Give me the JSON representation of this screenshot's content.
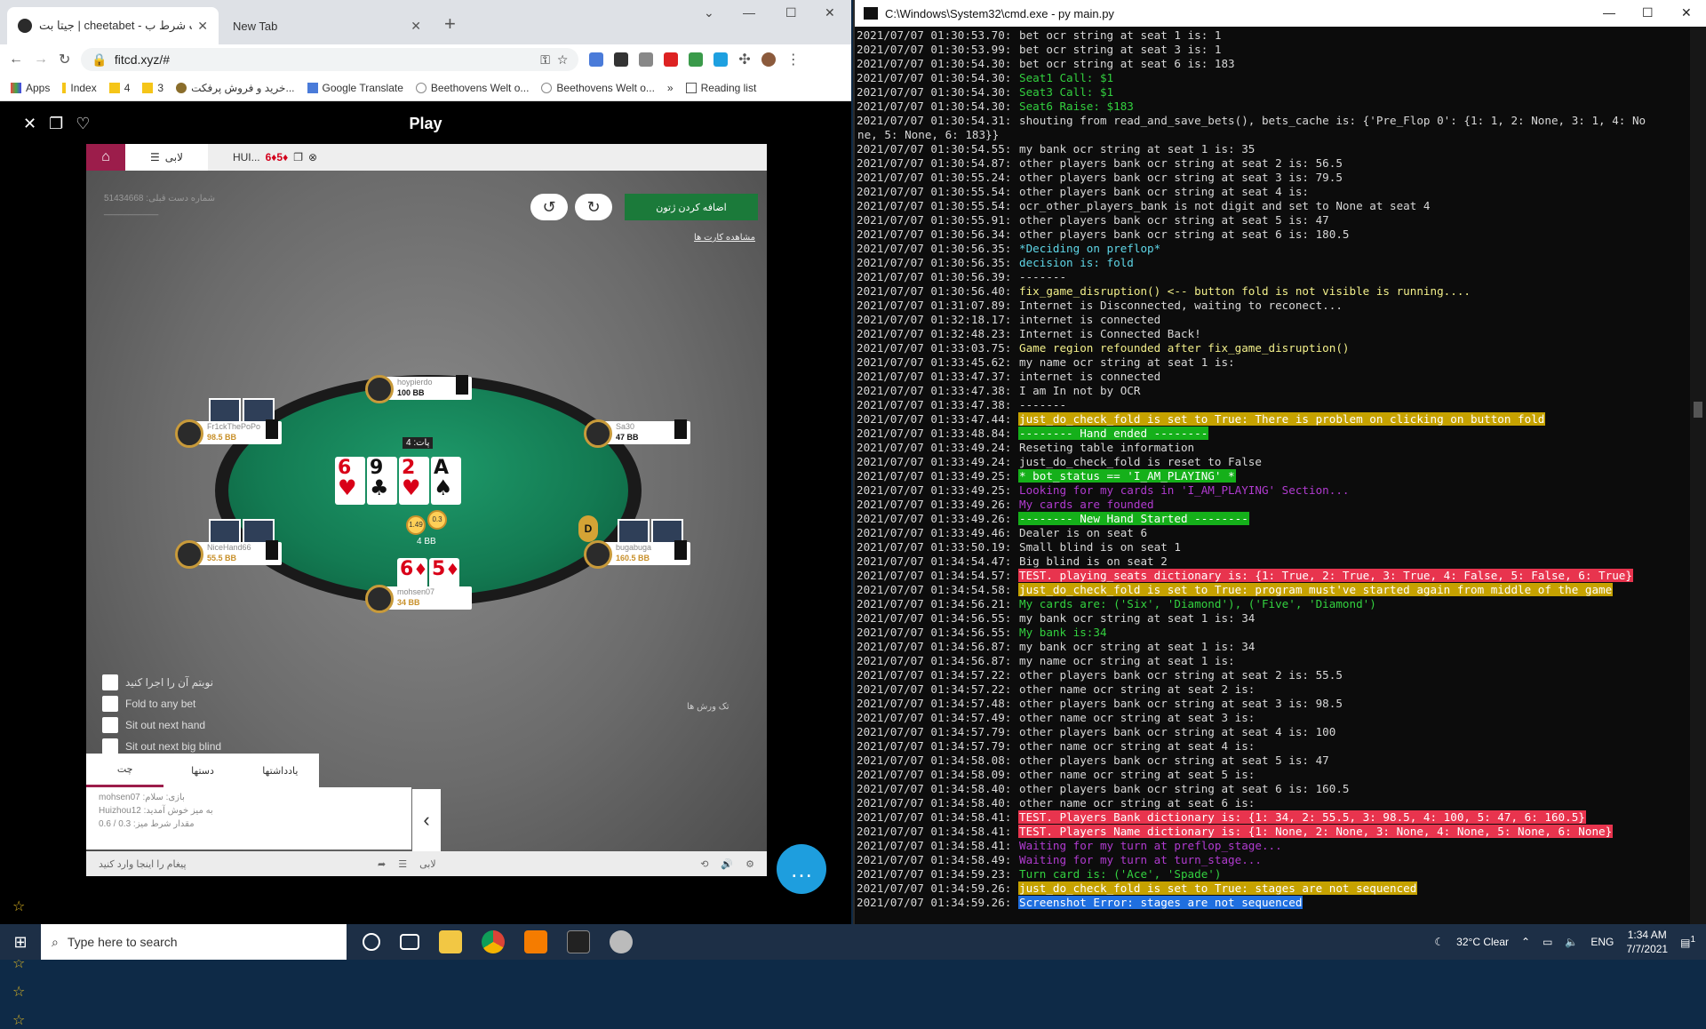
{
  "browser": {
    "tabs": [
      {
        "title": "جیتا بت | cheetabet - سایت شرط ب"
      },
      {
        "title": "New Tab"
      }
    ],
    "url": "fitcd.xyz/#",
    "bookmarks": [
      "Apps",
      "Index",
      "4",
      "3",
      "خرید و فروش پرفکت...",
      "Google Translate",
      "Beethovens Welt o...",
      "Beethovens Welt o..."
    ],
    "more_bookmarks": "»",
    "reading_list": "Reading list"
  },
  "page": {
    "title": "Play",
    "tab_lobby": "لابی",
    "tab_game_name": "HUI...",
    "tab_game_cards": "6♦5♦",
    "green_button": "اضافه کردن ژتون",
    "muted_line1": "51434668 :شماره دست قبلی",
    "muted_line2": "___________",
    "show_cards_link": "مشاهده کارت ها",
    "board": [
      {
        "rank": "6",
        "suit": "♥",
        "color": "red"
      },
      {
        "rank": "9",
        "suit": "♣",
        "color": "black"
      },
      {
        "rank": "2",
        "suit": "♥",
        "color": "red"
      },
      {
        "rank": "A",
        "suit": "♠",
        "color": "black"
      }
    ],
    "hero_cards": [
      {
        "rank": "6",
        "suit": "♦",
        "color": "red"
      },
      {
        "rank": "5",
        "suit": "♦",
        "color": "red"
      }
    ],
    "pot_label": "پات: 4",
    "pot_bb": "4 BB",
    "chip_left": "1.49",
    "chip_right": "0.3",
    "dealer": "D",
    "seats": [
      {
        "name": "hoypierdo",
        "bb": "100 BB"
      },
      {
        "name": "Fr1ckThePoPo",
        "bb": "98.5 BB"
      },
      {
        "name": "Sa30",
        "bb": "47 BB"
      },
      {
        "name": "NiceHand66",
        "bb": "55.5 BB"
      },
      {
        "name": "bugabuga",
        "bb": "160.5 BB"
      },
      {
        "name": "mohsen07",
        "bb": "34 BB"
      }
    ],
    "options": [
      "نوبتم آن را اجرا کنید",
      "Fold to any bet",
      "Sit out next hand",
      "Sit out next big blind"
    ],
    "right_note": "تک ورش ها",
    "chat_tabs": [
      "چت",
      "دستها",
      "یادداشتها"
    ],
    "chat_lines": [
      "mohsen07 :بازی: سلام",
      "Huizhou12 :به میز خوش آمدید",
      "مقدار شرط میز: 0.3 / 0.6"
    ],
    "chat_placeholder": "پیغام را اینجا وارد کنید",
    "lobby_bottom": "لابی"
  },
  "cmd": {
    "title": "C:\\Windows\\System32\\cmd.exe - py  main.py",
    "lines": [
      {
        "t": "2021/07/07 01:30:53.70: ",
        "m": "bet ocr string at seat 1 is: 1",
        "s": "white"
      },
      {
        "t": "2021/07/07 01:30:53.99: ",
        "m": "bet ocr string at seat 3 is: 1",
        "s": "white"
      },
      {
        "t": "2021/07/07 01:30:54.30: ",
        "m": "bet ocr string at seat 6 is: 183",
        "s": "white"
      },
      {
        "t": "2021/07/07 01:30:54.30: ",
        "m": "Seat1 Call: $1",
        "s": "green"
      },
      {
        "t": "2021/07/07 01:30:54.30: ",
        "m": "Seat3 Call: $1",
        "s": "green"
      },
      {
        "t": "2021/07/07 01:30:54.30: ",
        "m": "Seat6 Raise: $183",
        "s": "green"
      },
      {
        "t": "2021/07/07 01:30:54.31: ",
        "m": "shouting from read_and_save_bets(), bets_cache is: {'Pre_Flop 0': {1: 1, 2: None, 3: 1, 4: No",
        "s": "white"
      },
      {
        "t": "",
        "m": "ne, 5: None, 6: 183}}",
        "s": "white"
      },
      {
        "t": "2021/07/07 01:30:54.55: ",
        "m": "my bank ocr string at seat 1 is: 35",
        "s": "white"
      },
      {
        "t": "2021/07/07 01:30:54.87: ",
        "m": "other players bank ocr string at seat 2 is: 56.5",
        "s": "white"
      },
      {
        "t": "2021/07/07 01:30:55.24: ",
        "m": "other players bank ocr string at seat 3 is: 79.5",
        "s": "white"
      },
      {
        "t": "2021/07/07 01:30:55.54: ",
        "m": "other players bank ocr string at seat 4 is:",
        "s": "white"
      },
      {
        "t": "2021/07/07 01:30:55.54: ",
        "m": "ocr_other_players_bank is not digit and set to None at seat 4",
        "s": "white"
      },
      {
        "t": "2021/07/07 01:30:55.91: ",
        "m": "other players bank ocr string at seat 5 is: 47",
        "s": "white"
      },
      {
        "t": "2021/07/07 01:30:56.34: ",
        "m": "other players bank ocr string at seat 6 is: 180.5",
        "s": "white"
      },
      {
        "t": "2021/07/07 01:30:56.35: ",
        "m": "*Deciding on preflop*",
        "s": "cyan"
      },
      {
        "t": "2021/07/07 01:30:56.35: ",
        "m": "decision is: fold",
        "s": "cyan"
      },
      {
        "t": "2021/07/07 01:30:56.39: ",
        "m": "-------",
        "s": "white"
      },
      {
        "t": "2021/07/07 01:30:56.40: ",
        "m": "fix_game_disruption() <-- button fold is not visible is running....",
        "s": "yellow"
      },
      {
        "t": "2021/07/07 01:31:07.89: ",
        "m": "Internet is Disconnected, waiting to reconect...",
        "s": "white"
      },
      {
        "t": "2021/07/07 01:32:18.17: ",
        "m": "internet is connected",
        "s": "white"
      },
      {
        "t": "2021/07/07 01:32:48.23: ",
        "m": "Internet is Connected Back!",
        "s": "white"
      },
      {
        "t": "2021/07/07 01:33:03.75: ",
        "m": "Game region refounded after fix_game_disruption()",
        "s": "yellow"
      },
      {
        "t": "2021/07/07 01:33:45.62: ",
        "m": "my name ocr string at seat 1 is:",
        "s": "white"
      },
      {
        "t": "2021/07/07 01:33:47.37: ",
        "m": "internet is connected",
        "s": "white"
      },
      {
        "t": "2021/07/07 01:33:47.38: ",
        "m": "I am In not by OCR",
        "s": "white"
      },
      {
        "t": "2021/07/07 01:33:47.38: ",
        "m": "-------",
        "s": "white"
      },
      {
        "t": "2021/07/07 01:33:47.44: ",
        "m": "just_do_check_fold is set to True: There is problem on clicking on button fold",
        "s": "bg-gold"
      },
      {
        "t": "2021/07/07 01:33:48.84: ",
        "m": "-------- Hand ended --------",
        "s": "bg-green"
      },
      {
        "t": "2021/07/07 01:33:49.24: ",
        "m": "Reseting table information",
        "s": "white"
      },
      {
        "t": "2021/07/07 01:33:49.24: ",
        "m": "just_do_check_fold is reset to False",
        "s": "white"
      },
      {
        "t": "2021/07/07 01:33:49.25: ",
        "m": "* bot_status == 'I_AM_PLAYING' *",
        "s": "bg-green"
      },
      {
        "t": "2021/07/07 01:33:49.25: ",
        "m": "Looking for my cards in 'I_AM_PLAYING' Section...",
        "s": "magenta"
      },
      {
        "t": "2021/07/07 01:33:49.26: ",
        "m": "My cards are founded",
        "s": "magenta"
      },
      {
        "t": "2021/07/07 01:33:49.26: ",
        "m": "-------- New Hand Started --------",
        "s": "bg-green"
      },
      {
        "t": "2021/07/07 01:33:49.46: ",
        "m": "Dealer is on seat 6",
        "s": "white"
      },
      {
        "t": "2021/07/07 01:33:50.19: ",
        "m": "Small blind is on seat 1",
        "s": "white"
      },
      {
        "t": "2021/07/07 01:34:54.47: ",
        "m": "Big blind is on seat 2",
        "s": "white"
      },
      {
        "t": "2021/07/07 01:34:54.57: ",
        "m": "TEST. playing_seats dictionary is: {1: True, 2: True, 3: True, 4: False, 5: False, 6: True}",
        "s": "bg-red"
      },
      {
        "t": "2021/07/07 01:34:54.58: ",
        "m": "just_do_check_fold is set to True: program must've started again from middle of the game",
        "s": "bg-gold"
      },
      {
        "t": "2021/07/07 01:34:56.21: ",
        "m": "My cards are: ('Six', 'Diamond'), ('Five', 'Diamond')",
        "s": "green"
      },
      {
        "t": "2021/07/07 01:34:56.55: ",
        "m": "my bank ocr string at seat 1 is: 34",
        "s": "white"
      },
      {
        "t": "2021/07/07 01:34:56.55: ",
        "m": "My bank is:34",
        "s": "green"
      },
      {
        "t": "2021/07/07 01:34:56.87: ",
        "m": "my bank ocr string at seat 1 is: 34",
        "s": "white"
      },
      {
        "t": "2021/07/07 01:34:56.87: ",
        "m": "my name ocr string at seat 1 is:",
        "s": "white"
      },
      {
        "t": "2021/07/07 01:34:57.22: ",
        "m": "other players bank ocr string at seat 2 is: 55.5",
        "s": "white"
      },
      {
        "t": "2021/07/07 01:34:57.22: ",
        "m": "other name ocr string at seat 2 is:",
        "s": "white"
      },
      {
        "t": "2021/07/07 01:34:57.48: ",
        "m": "other players bank ocr string at seat 3 is: 98.5",
        "s": "white"
      },
      {
        "t": "2021/07/07 01:34:57.49: ",
        "m": "other name ocr string at seat 3 is:",
        "s": "white"
      },
      {
        "t": "2021/07/07 01:34:57.79: ",
        "m": "other players bank ocr string at seat 4 is: 100",
        "s": "white"
      },
      {
        "t": "2021/07/07 01:34:57.79: ",
        "m": "other name ocr string at seat 4 is:",
        "s": "white"
      },
      {
        "t": "2021/07/07 01:34:58.08: ",
        "m": "other players bank ocr string at seat 5 is: 47",
        "s": "white"
      },
      {
        "t": "2021/07/07 01:34:58.09: ",
        "m": "other name ocr string at seat 5 is:",
        "s": "white"
      },
      {
        "t": "2021/07/07 01:34:58.40: ",
        "m": "other players bank ocr string at seat 6 is: 160.5",
        "s": "white"
      },
      {
        "t": "2021/07/07 01:34:58.40: ",
        "m": "other name ocr string at seat 6 is:",
        "s": "white"
      },
      {
        "t": "2021/07/07 01:34:58.41: ",
        "m": "TEST. Players Bank dictionary is: {1: 34, 2: 55.5, 3: 98.5, 4: 100, 5: 47, 6: 160.5}",
        "s": "bg-red"
      },
      {
        "t": "2021/07/07 01:34:58.41: ",
        "m": "TEST. Players Name dictionary is: {1: None, 2: None, 3: None, 4: None, 5: None, 6: None}",
        "s": "bg-red"
      },
      {
        "t": "2021/07/07 01:34:58.41: ",
        "m": "Waiting for my turn at preflop_stage...",
        "s": "magenta"
      },
      {
        "t": "2021/07/07 01:34:58.49: ",
        "m": "Waiting for my turn at turn_stage...",
        "s": "magenta"
      },
      {
        "t": "2021/07/07 01:34:59.23: ",
        "m": "Turn card is: ('Ace', 'Spade')",
        "s": "green"
      },
      {
        "t": "2021/07/07 01:34:59.26: ",
        "m": "just_do_check_fold is set to True: stages are not sequenced",
        "s": "bg-gold"
      },
      {
        "t": "2021/07/07 01:34:59.26: ",
        "m": "Screenshot Error: stages are not sequenced",
        "s": "bg-blue"
      }
    ]
  },
  "taskbar": {
    "search_placeholder": "Type here to search",
    "weather": "32°C  Clear",
    "lang": "ENG",
    "time": "1:34 AM",
    "date": "7/7/2021",
    "notif_count": "1"
  }
}
